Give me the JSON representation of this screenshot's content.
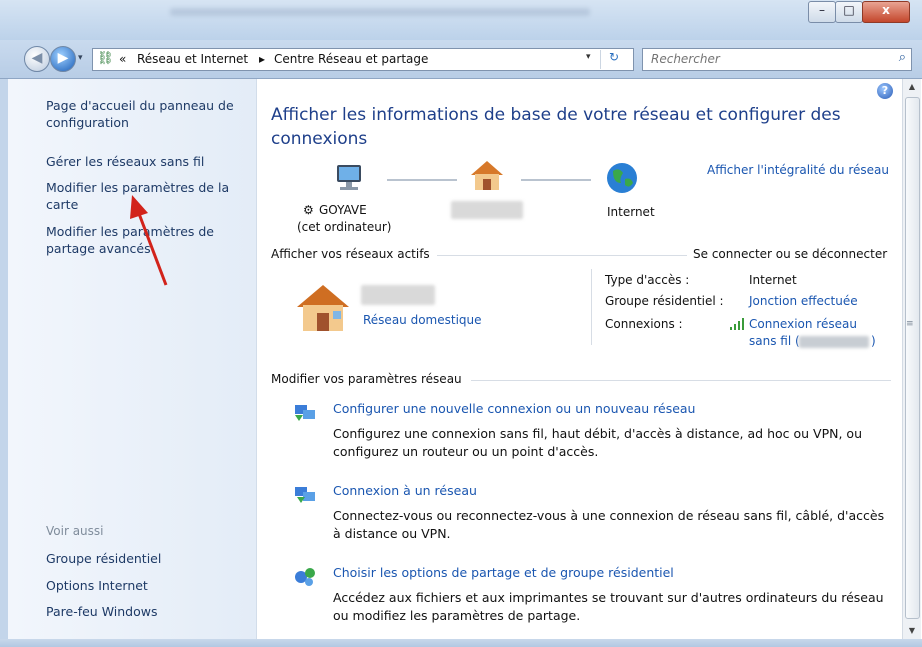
{
  "window": {
    "minimize_label": "–",
    "maximize_label": "□",
    "close_label": "x"
  },
  "address": {
    "history_arrow": "▾",
    "chevron": "«",
    "crumb1": "Réseau et Internet",
    "separator": "▸",
    "crumb2": "Centre Réseau et partage",
    "dropdown": "▾",
    "refresh": "↻"
  },
  "search": {
    "placeholder": "Rechercher"
  },
  "left_pane": {
    "links": [
      "Page d'accueil du panneau de configuration",
      "Gérer les réseaux sans fil",
      "Modifier les paramètres de la carte",
      "Modifier les paramètres de partage avancés"
    ],
    "see_also_heading": "Voir aussi",
    "see_also": [
      "Groupe résidentiel",
      "Options Internet",
      "Pare-feu Windows"
    ]
  },
  "main": {
    "help": "?",
    "title": "Afficher les informations de base de votre réseau et configurer des connexions",
    "full_map_link": "Afficher l'intégralité du réseau",
    "computer_name": "GOYAVE",
    "computer_sub": "(cet ordinateur)",
    "internet_label": "Internet",
    "active_networks_heading": "Afficher vos réseaux actifs",
    "connect_link": "Se connecter ou se déconnecter",
    "network_type_link": "Réseau domestique",
    "access_type_label": "Type d'accès :",
    "access_type_value": "Internet",
    "homegroup_label": "Groupe résidentiel :",
    "homegroup_value": "Jonction effectuée",
    "connections_label": "Connexions :",
    "connection_value_line1": "Connexion réseau",
    "connection_value_line2": "sans fil (",
    "connection_value_end": ")",
    "settings_heading": "Modifier vos paramètres réseau",
    "tasks": [
      {
        "title": "Configurer une nouvelle connexion ou un nouveau réseau",
        "desc": "Configurez une connexion sans fil, haut débit, d'accès à distance, ad hoc ou VPN, ou configurez un routeur ou un point d'accès."
      },
      {
        "title": "Connexion à un réseau",
        "desc": "Connectez-vous ou reconnectez-vous à une connexion de réseau sans fil, câblé, d'accès à distance ou VPN."
      },
      {
        "title": "Choisir les options de partage et de groupe résidentiel",
        "desc": "Accédez aux fichiers et aux imprimantes se trouvant sur d'autres ordinateurs du réseau ou modifiez les paramètres de partage."
      }
    ]
  },
  "colors": {
    "link": "#1a56b0",
    "title": "#1e3f8a",
    "arrow": "#d2231b"
  }
}
